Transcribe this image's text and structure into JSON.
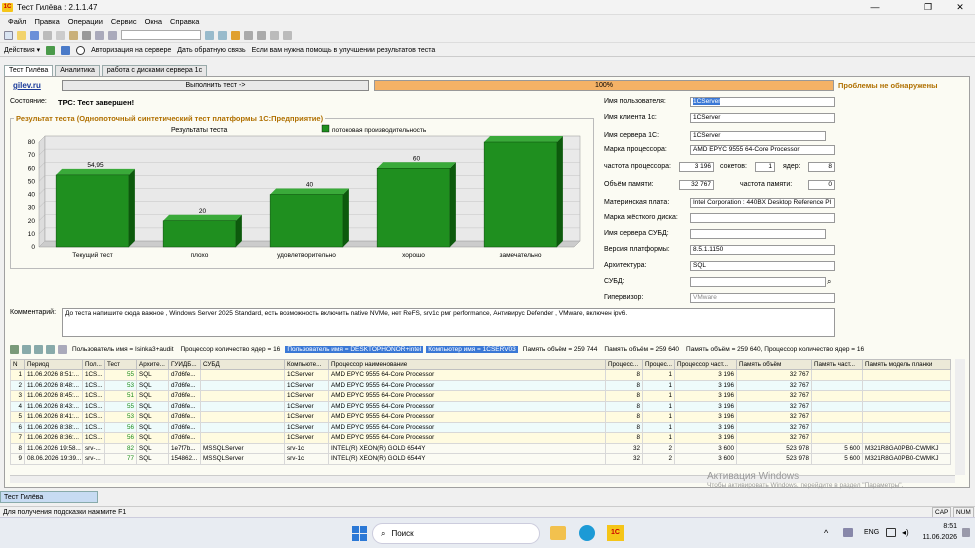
{
  "window": {
    "title": "Тест Гилёва : 2.1.1.47",
    "app_logo": "1С",
    "minimize": "—",
    "maximize": "❐",
    "close": "✕"
  },
  "menu": [
    "Файл",
    "Правка",
    "Операции",
    "Сервис",
    "Окна",
    "Справка"
  ],
  "actions": {
    "label": "Действия ▾",
    "items": [
      "Авторизация на сервере",
      "Дать обратную связь",
      "Если вам нужна помощь в улучшении результатов теста"
    ]
  },
  "tabs": [
    "Тест Гилёва",
    "Аналитика",
    "работа с дисками сервера 1с"
  ],
  "panel": {
    "link": "gilev.ru",
    "run_button": "Выполнить тест ->",
    "progress": "100%",
    "progress_value": 1.0,
    "problems": "Проблемы не обнаружены",
    "state_label": "Состояние:",
    "state_value": "ТРС: Тест завершен!",
    "comment_label": "Комментарий:",
    "comment": "До теста напишите сюда важное , Windows Server 2025 Standard, есть возможность включить native NVMe, нет ReFS, srv1c рмг performance, Антивирус Defender , VMware, включен ipv6."
  },
  "chart_data": {
    "type": "bar",
    "box_title": "Результат теста (Однопоточный синтетический тест платформы 1С:Предприятие)",
    "title": "Результаты теста",
    "legend": "потоковая производительность",
    "categories": [
      "Текущий тест",
      "плохо",
      "удовлетворительно",
      "хорошо",
      "замечательно"
    ],
    "values": [
      54.95,
      20,
      40,
      60,
      80
    ],
    "labels": [
      "54,95",
      "20",
      "40",
      "60",
      ""
    ],
    "ylim": [
      0,
      80
    ],
    "yticks": [
      0,
      10,
      20,
      30,
      40,
      50,
      60,
      70,
      80
    ],
    "color": "#1f8f1f",
    "grid": true
  },
  "info": {
    "user_label": "Имя пользователя:",
    "user": "1CServer",
    "client_label": "Имя клиента 1с:",
    "client": "1CServer",
    "server_label": "Имя сервера 1С:",
    "server": "1CServer",
    "cpu_label": "Марка процессора:",
    "cpu": "AMD EPYC 9555 64-Core Processor",
    "freq_label": "частота процессора:",
    "freq": "3 196",
    "sockets_label": "сокетов:",
    "sockets": "1",
    "cores_label": "ядер:",
    "cores": "8",
    "mem_label": "Объём памяти:",
    "mem": "32 767",
    "memfreq_label": "частота памяти:",
    "memfreq": "0",
    "board_label": "Материнская плата:",
    "board": "Intel Corporation : 440BX Desktop Reference Pl",
    "disk_label": "Марка жёсткого диска:",
    "disk": "",
    "dbserver_label": "Имя сервера СУБД:",
    "dbserver": "",
    "platform_label": "Версия платформы:",
    "platform": "8.5.1.1150",
    "arch_label": "Архитектура:",
    "arch": "SQL",
    "dbms_label": "СУБД:",
    "dbms": "",
    "hyper_label": "Гипервизор:",
    "hyper": "VMware"
  },
  "filters": [
    "Пользователь имя = Isinka3+audit",
    "Процессор количество ядер = 16",
    "Пользователь имя = DESKTOPHONOR+intel",
    "Компьютер имя = 1CSERV03",
    "Память объём = 259 744",
    "Память объём = 259 640",
    "Память объём = 259 640, Процессор количество ядер = 16"
  ],
  "table": {
    "headers": [
      "N",
      "Период",
      "Пол...",
      "Тест",
      "Архите...",
      "ГУИДБ...",
      "СУБД",
      "Компьюте...",
      "Процессор наименование",
      "Процесс...",
      "Процес...",
      "Процессор част...",
      "Память объём",
      "Память част...",
      "Память модель планки"
    ],
    "rows": [
      [
        "1",
        "11.06.2026 8:51:...",
        "1CS...",
        "55",
        "SQL",
        "d7d6fe...",
        "",
        "1CServer",
        "AMD EPYC 9555 64-Core Processor",
        "8",
        "1",
        "3 196",
        "32 767",
        "",
        ""
      ],
      [
        "2",
        "11.06.2026 8:48:...",
        "1CS...",
        "53",
        "SQL",
        "d7d6fe...",
        "",
        "1CServer",
        "AMD EPYC 9555 64-Core Processor",
        "8",
        "1",
        "3 196",
        "32 767",
        "",
        ""
      ],
      [
        "3",
        "11.06.2026 8:45:...",
        "1CS...",
        "51",
        "SQL",
        "d7d6fe...",
        "",
        "1CServer",
        "AMD EPYC 9555 64-Core Processor",
        "8",
        "1",
        "3 196",
        "32 767",
        "",
        ""
      ],
      [
        "4",
        "11.06.2026 8:43:...",
        "1CS...",
        "55",
        "SQL",
        "d7d6fe...",
        "",
        "1CServer",
        "AMD EPYC 9555 64-Core Processor",
        "8",
        "1",
        "3 196",
        "32 767",
        "",
        ""
      ],
      [
        "5",
        "11.06.2026 8:41:...",
        "1CS...",
        "53",
        "SQL",
        "d7d6fe...",
        "",
        "1CServer",
        "AMD EPYC 9555 64-Core Processor",
        "8",
        "1",
        "3 196",
        "32 767",
        "",
        ""
      ],
      [
        "6",
        "11.06.2026 8:38:...",
        "1CS...",
        "56",
        "SQL",
        "d7d6fe...",
        "",
        "1CServer",
        "AMD EPYC 9555 64-Core Processor",
        "8",
        "1",
        "3 196",
        "32 767",
        "",
        ""
      ],
      [
        "7",
        "11.06.2026 8:36:...",
        "1CS...",
        "56",
        "SQL",
        "d7d6fe...",
        "",
        "1CServer",
        "AMD EPYC 9555 64-Core Processor",
        "8",
        "1",
        "3 196",
        "32 767",
        "",
        ""
      ],
      [
        "8",
        "11.06.2026 19:58...",
        "srv-...",
        "82",
        "SQL",
        "1e7f7b...",
        "MSSQLServer",
        "srv-1c",
        "INTEL(R) XEON(R) GOLD 6544Y",
        "32",
        "2",
        "3 600",
        "523 978",
        "5 600",
        "M321R8GA0PB0-CWMKJ"
      ],
      [
        "9",
        "08.06.2026 19:39...",
        "srv-...",
        "77",
        "SQL",
        "154862...",
        "MSSQLServer",
        "srv-1c",
        "INTEL(R) XEON(R) GOLD 6544Y",
        "32",
        "2",
        "3 600",
        "523 978",
        "5 600",
        "M321R8GA0PB0-CWMKJ"
      ]
    ]
  },
  "bottom_tab": "Тест Гилёва",
  "status": {
    "hint": "Для получения подсказки нажмите F1",
    "cap": "CAP",
    "num": "NUM"
  },
  "watermark": {
    "line1": "Активация Windows",
    "line2": "Чтобы активировать Windows, перейдите в раздел \"Параметры\"."
  },
  "taskbar": {
    "search": "Поиск",
    "lang": "ENG",
    "time": "8:51",
    "date": "11.06.2026"
  }
}
